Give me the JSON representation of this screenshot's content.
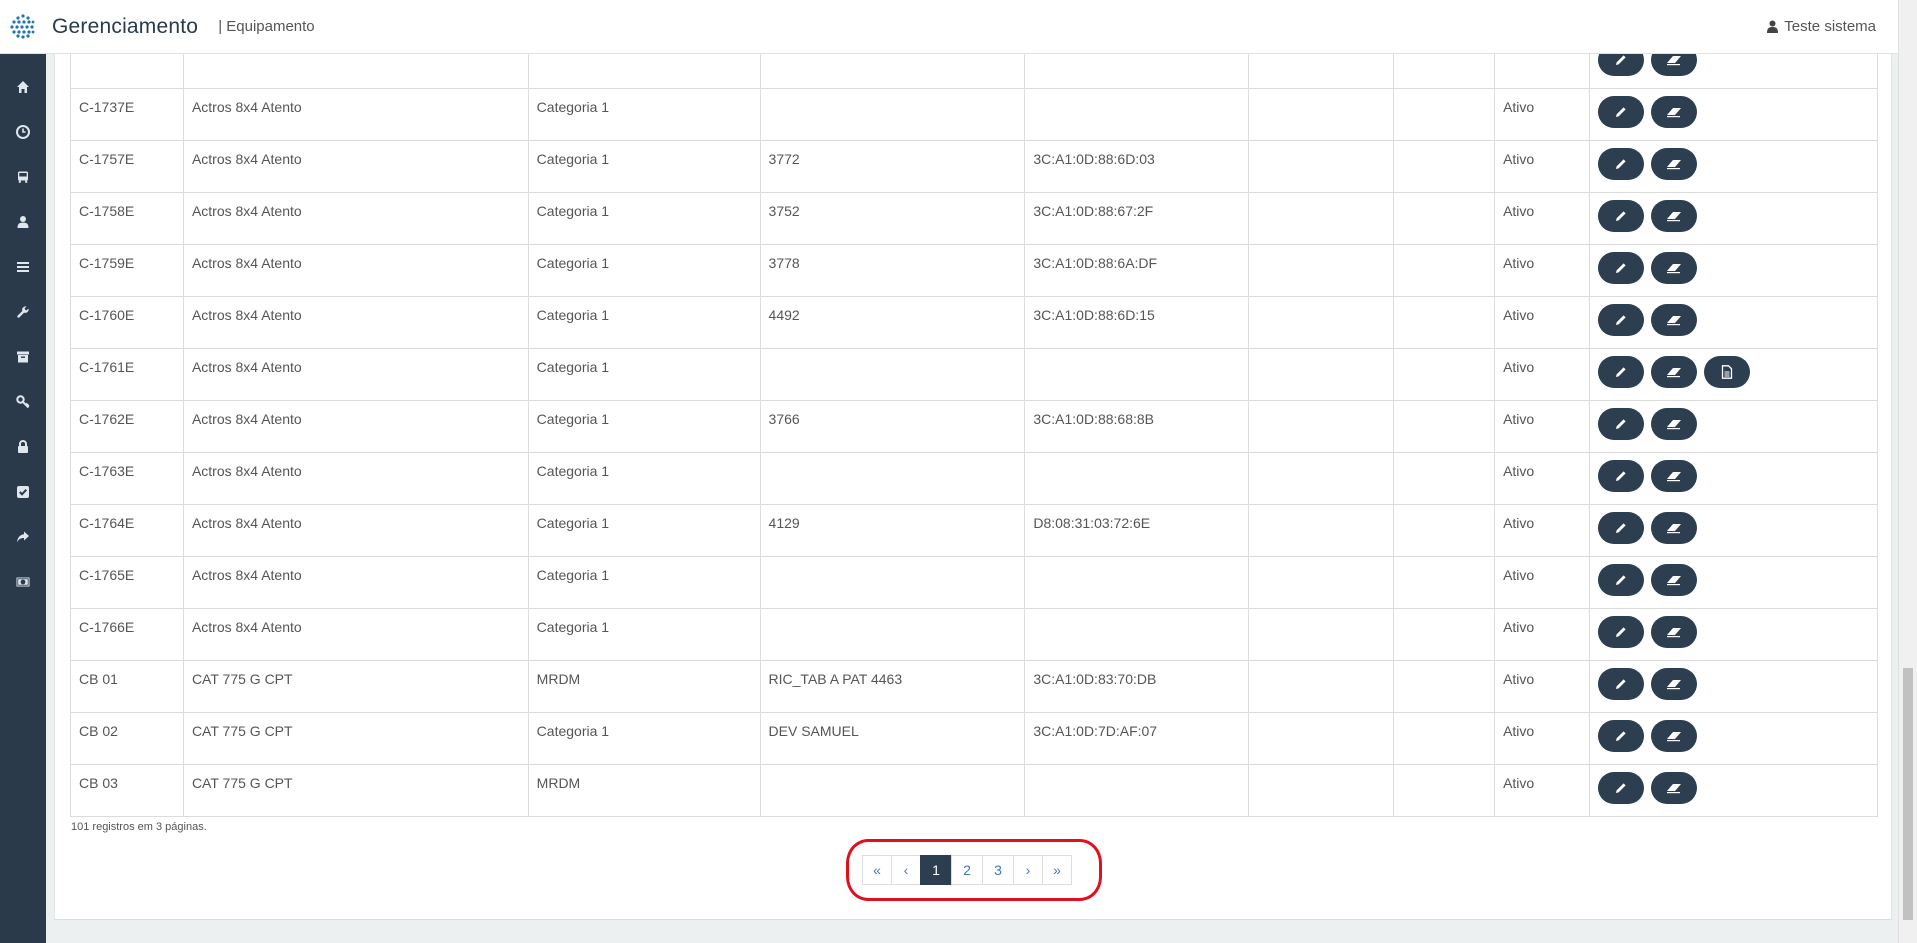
{
  "header": {
    "app_title": "Gerenciamento",
    "crumb": "| Equipamento",
    "user": "Teste sistema"
  },
  "sidebar": {
    "items": [
      {
        "icon": "home-icon"
      },
      {
        "icon": "clock-icon"
      },
      {
        "icon": "bus-icon"
      },
      {
        "icon": "user-icon"
      },
      {
        "icon": "list-icon"
      },
      {
        "icon": "wrench-icon"
      },
      {
        "icon": "archive-icon"
      },
      {
        "icon": "key-icon"
      },
      {
        "icon": "lock-icon"
      },
      {
        "icon": "check-square-icon"
      },
      {
        "icon": "share-icon"
      },
      {
        "icon": "money-icon"
      }
    ]
  },
  "table": {
    "rows": [
      {
        "code": "",
        "model": "",
        "category": "",
        "tag": "",
        "mac": "",
        "status": "",
        "extra": false
      },
      {
        "code": "C-1737E",
        "model": "Actros 8x4 Atento",
        "category": "Categoria 1",
        "tag": "",
        "mac": "",
        "status": "Ativo",
        "extra": false
      },
      {
        "code": "C-1757E",
        "model": "Actros 8x4 Atento",
        "category": "Categoria 1",
        "tag": "3772",
        "mac": "3C:A1:0D:88:6D:03",
        "status": "Ativo",
        "extra": false
      },
      {
        "code": "C-1758E",
        "model": "Actros 8x4 Atento",
        "category": "Categoria 1",
        "tag": "3752",
        "mac": "3C:A1:0D:88:67:2F",
        "status": "Ativo",
        "extra": false
      },
      {
        "code": "C-1759E",
        "model": "Actros 8x4 Atento",
        "category": "Categoria 1",
        "tag": "3778",
        "mac": "3C:A1:0D:88:6A:DF",
        "status": "Ativo",
        "extra": false
      },
      {
        "code": "C-1760E",
        "model": "Actros 8x4 Atento",
        "category": "Categoria 1",
        "tag": "4492",
        "mac": "3C:A1:0D:88:6D:15",
        "status": "Ativo",
        "extra": false
      },
      {
        "code": "C-1761E",
        "model": "Actros 8x4 Atento",
        "category": "Categoria 1",
        "tag": "",
        "mac": "",
        "status": "Ativo",
        "extra": true
      },
      {
        "code": "C-1762E",
        "model": "Actros 8x4 Atento",
        "category": "Categoria 1",
        "tag": "3766",
        "mac": "3C:A1:0D:88:68:8B",
        "status": "Ativo",
        "extra": false
      },
      {
        "code": "C-1763E",
        "model": "Actros 8x4 Atento",
        "category": "Categoria 1",
        "tag": "",
        "mac": "",
        "status": "Ativo",
        "extra": false
      },
      {
        "code": "C-1764E",
        "model": "Actros 8x4 Atento",
        "category": "Categoria 1",
        "tag": "4129",
        "mac": "D8:08:31:03:72:6E",
        "status": "Ativo",
        "extra": false
      },
      {
        "code": "C-1765E",
        "model": "Actros 8x4 Atento",
        "category": "Categoria 1",
        "tag": "",
        "mac": "",
        "status": "Ativo",
        "extra": false
      },
      {
        "code": "C-1766E",
        "model": "Actros 8x4 Atento",
        "category": "Categoria 1",
        "tag": "",
        "mac": "",
        "status": "Ativo",
        "extra": false
      },
      {
        "code": "CB 01",
        "model": "CAT 775 G CPT",
        "category": "MRDM",
        "tag": "RIC_TAB A PAT 4463",
        "mac": "3C:A1:0D:83:70:DB",
        "status": "Ativo",
        "extra": false
      },
      {
        "code": "CB 02",
        "model": "CAT 775 G CPT",
        "category": "Categoria 1",
        "tag": "DEV SAMUEL",
        "mac": "3C:A1:0D:7D:AF:07",
        "status": "Ativo",
        "extra": false
      },
      {
        "code": "CB 03",
        "model": "CAT 775 G CPT",
        "category": "MRDM",
        "tag": "",
        "mac": "",
        "status": "Ativo",
        "extra": false
      }
    ]
  },
  "footer": {
    "info": "101 registros em 3 páginas."
  },
  "pagination": {
    "items": [
      {
        "label": "«",
        "name": "first-page-button",
        "active": false
      },
      {
        "label": "‹",
        "name": "prev-page-button",
        "active": false
      },
      {
        "label": "1",
        "name": "page-1-button",
        "active": true
      },
      {
        "label": "2",
        "name": "page-2-button",
        "active": false
      },
      {
        "label": "3",
        "name": "page-3-button",
        "active": false
      },
      {
        "label": "›",
        "name": "next-page-button",
        "active": false
      },
      {
        "label": "»",
        "name": "last-page-button",
        "active": false
      }
    ]
  },
  "colors": {
    "sidebar": "#2a3a4b",
    "action_button": "#2c3e50",
    "highlight": "#e0101f",
    "link": "#3c7ab8"
  }
}
